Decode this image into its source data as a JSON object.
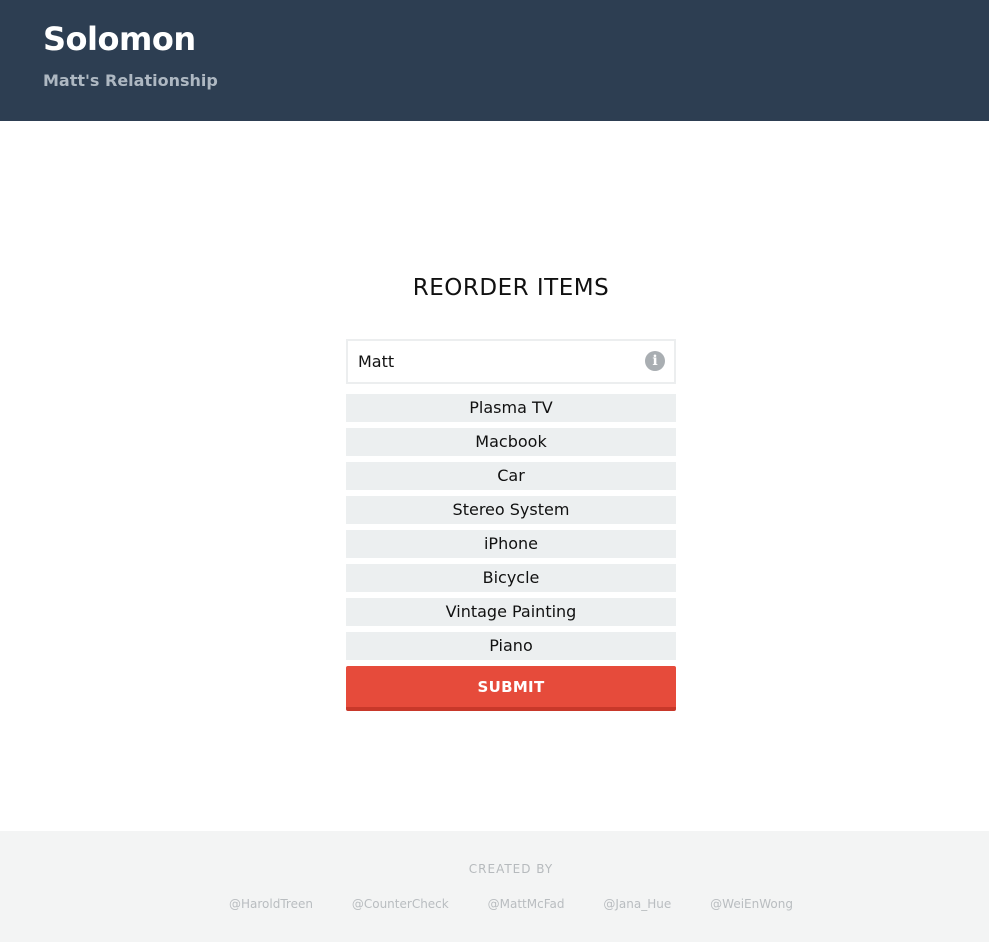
{
  "header": {
    "title": "Solomon",
    "subtitle": "Matt's Relationship"
  },
  "main": {
    "section_title": "REORDER ITEMS",
    "name_field": {
      "value": "Matt",
      "info_icon_glyph": "i",
      "icon_name": "info-icon"
    },
    "items": [
      {
        "label": "Plasma TV"
      },
      {
        "label": "Macbook"
      },
      {
        "label": "Car"
      },
      {
        "label": "Stereo System"
      },
      {
        "label": "iPhone"
      },
      {
        "label": "Bicycle"
      },
      {
        "label": "Vintage Painting"
      },
      {
        "label": "Piano"
      }
    ],
    "submit_label": "SUBMIT"
  },
  "footer": {
    "created_by_label": "CREATED BY",
    "credits": [
      {
        "label": "@HaroldTreen"
      },
      {
        "label": "@CounterCheck"
      },
      {
        "label": "@MattMcFad"
      },
      {
        "label": "@Jana_Hue"
      },
      {
        "label": "@WeiEnWong"
      }
    ]
  },
  "colors": {
    "header_bg": "#2d3e52",
    "accent": "#e64b3b",
    "item_bg": "#eceff0",
    "footer_bg": "#f3f4f4"
  }
}
